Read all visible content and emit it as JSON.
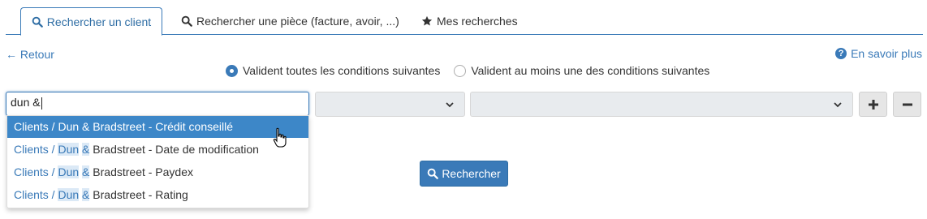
{
  "tabs": [
    {
      "label": "Rechercher un client",
      "icon": "search-icon",
      "active": true
    },
    {
      "label": "Rechercher une pièce (facture, avoir, ...)",
      "icon": "search-icon",
      "active": false
    },
    {
      "label": "Mes recherches",
      "icon": "star-icon",
      "active": false
    }
  ],
  "nav": {
    "back_label": "← Retour",
    "help_label": "En savoir plus"
  },
  "conditions": {
    "all_label": "Validen toutes les conditions suivantes",
    "any_label": "Valident au moins une des conditions suivantes",
    "selected": "all"
  },
  "criteria": {
    "field_value": "dun &",
    "operator_value": "",
    "value_value": ""
  },
  "dropdown": {
    "items": [
      {
        "prefix": "Clients / ",
        "match1": "Dun",
        "sep": " ",
        "match2": "&",
        "suffix": " Bradstreet - Crédit conseillé",
        "selected": true
      },
      {
        "prefix": "Clients / ",
        "match1": "Dun",
        "sep": " ",
        "match2": "&",
        "suffix": " Bradstreet - Date de modification",
        "selected": false
      },
      {
        "prefix": "Clients / ",
        "match1": "Dun",
        "sep": " ",
        "match2": "&",
        "suffix": " Bradstreet - Paydex",
        "selected": false
      },
      {
        "prefix": "Clients / ",
        "match1": "Dun",
        "sep": " ",
        "match2": "&",
        "suffix": " Bradstreet - Rating",
        "selected": false
      }
    ]
  },
  "actions": {
    "search_label": "Rechercher"
  },
  "colors": {
    "accent": "#3a7ab8",
    "selected_row": "#3d87c8",
    "highlight": "#dbe9f6"
  }
}
